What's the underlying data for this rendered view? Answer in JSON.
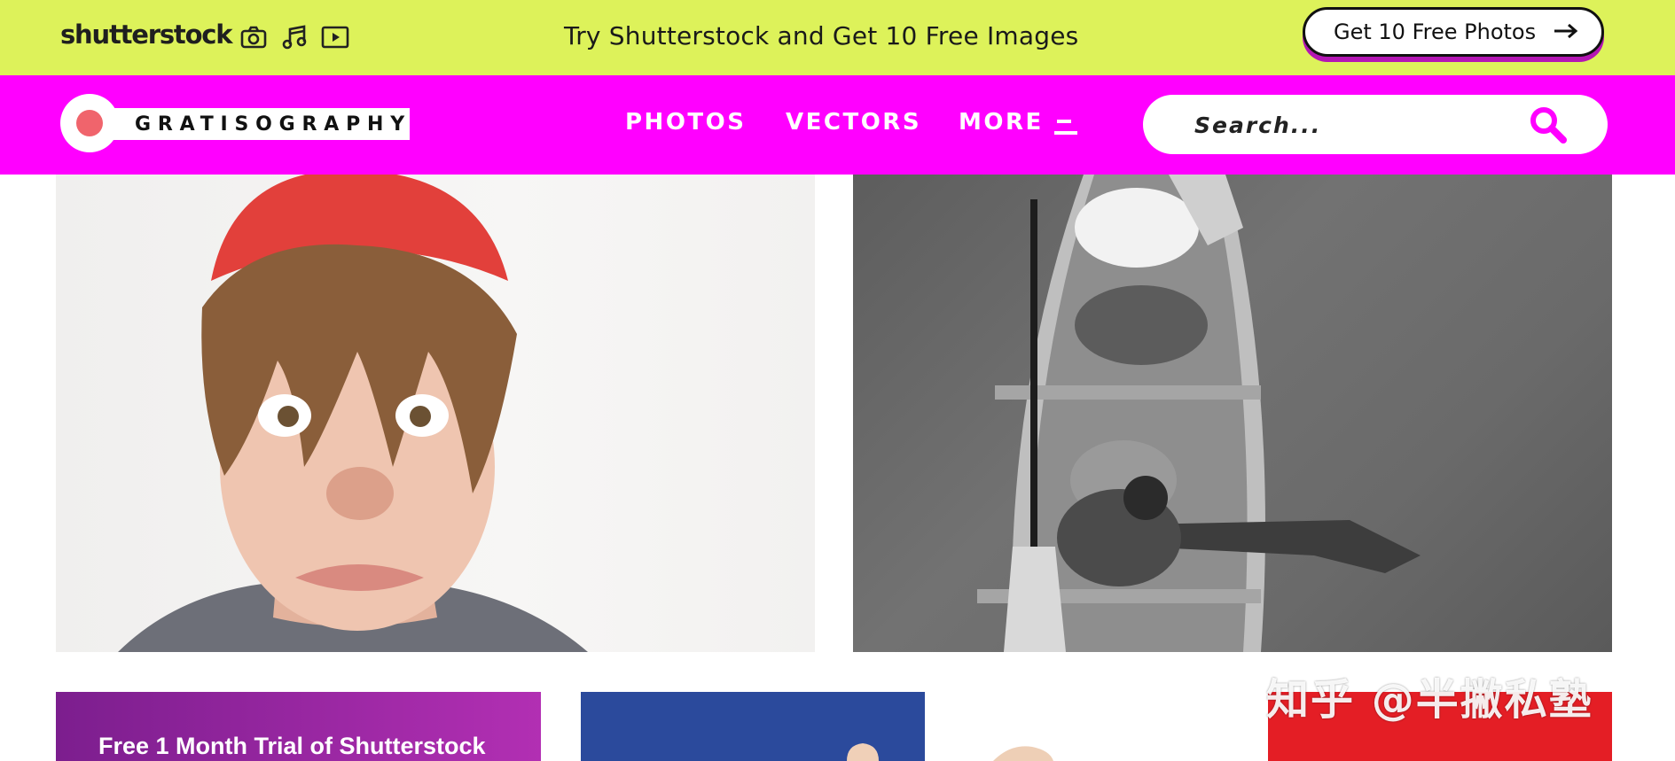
{
  "promo_bar": {
    "brand": "shutterstock",
    "icons": [
      "camera-icon",
      "music-note-icon",
      "video-play-icon"
    ],
    "headline": "Try Shutterstock and Get 10 Free Images",
    "cta_label": "Get 10 Free Photos",
    "cta_icon": "arrow-right-icon",
    "background": "#ddf25a"
  },
  "nav": {
    "brand": "GRATISOGRAPHY",
    "links": [
      "PHOTOS",
      "VECTORS",
      "MORE"
    ],
    "more_icon": "menu-lines-icon",
    "search_placeholder": "Search...",
    "search_icon": "search-icon",
    "background": "#ff00ff",
    "accent": "#f0646c"
  },
  "gallery": {
    "tiles": [
      {
        "label": "Free 1 Month Trial of Shutterstock"
      }
    ]
  },
  "watermark": "知乎 @半撇私塾"
}
